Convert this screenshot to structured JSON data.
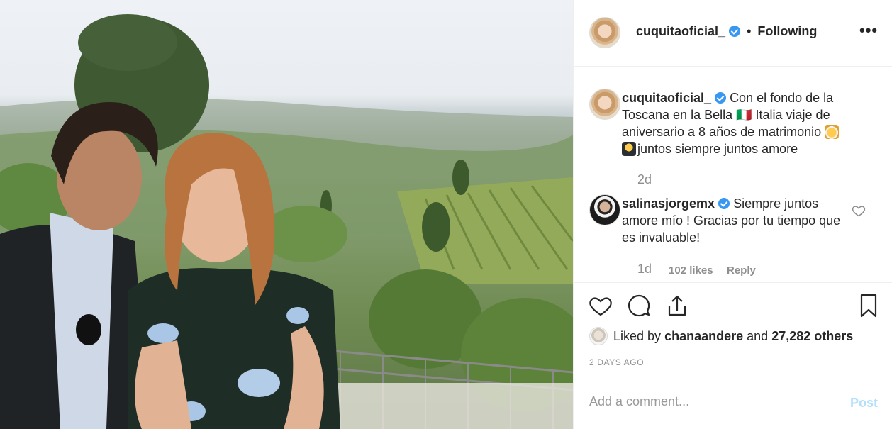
{
  "photo": {
    "alt_icon": "photo-icon"
  },
  "header": {
    "username": "cuquitaoficial_",
    "separator": "•",
    "follow_status": "Following",
    "more_label": "•••"
  },
  "caption": {
    "username": "cuquitaoficial_",
    "text_before_emoji": "Con el fondo de la Toscana en la Bella 🇮🇹 Italia viaje de aniversario a 8 años de matrimonio ",
    "text_after_emoji": "juntos siempre juntos amore",
    "age": "2d"
  },
  "comment": {
    "username": "salinasjorgemx",
    "text": "Siempre juntos amore mío ! Gracias por tu tiempo que es invaluable!",
    "age": "1d",
    "likes": "102 likes",
    "reply_label": "Reply"
  },
  "likes": {
    "prefix": "Liked by",
    "user": "chanaandere",
    "and": "and",
    "others": "27,282 others"
  },
  "timestamp": "2 DAYS AGO",
  "add_comment": {
    "placeholder": "Add a comment...",
    "post_label": "Post"
  },
  "colors": {
    "verified": "#3897f0",
    "muted_text": "#8e8e8e",
    "post_disabled": "#b2dffc",
    "border": "#efefef"
  }
}
